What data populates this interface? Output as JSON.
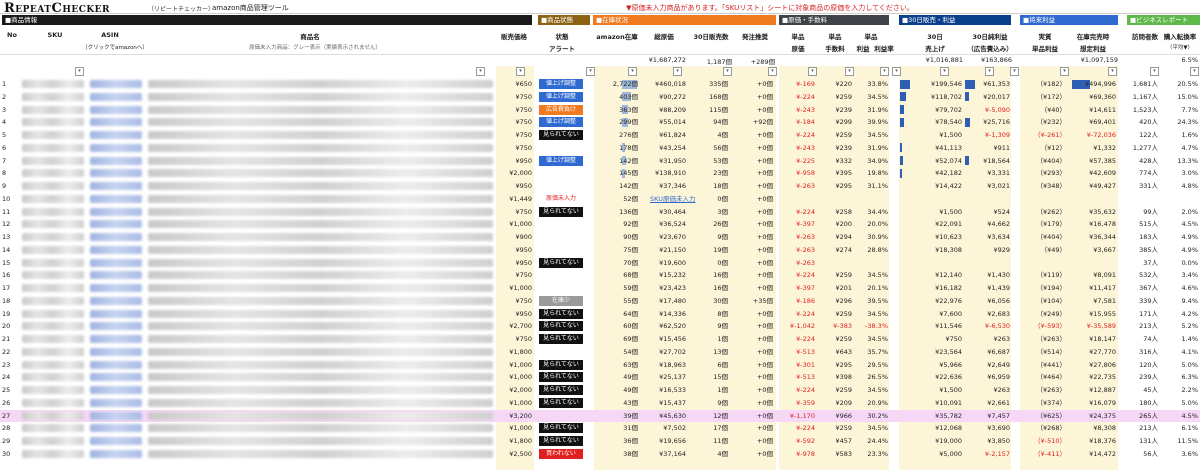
{
  "app": {
    "logo": "RepeatChecker",
    "logo_sub": "（リピートチェッカー）",
    "tool_name": "amazon商品管理ツール",
    "warning": "▼原価未入力商品があります。「SKUリスト」シートに対象商品の原価を入力してください。"
  },
  "sections": [
    {
      "label": "■商品情報",
      "color": "#1a1a1a"
    },
    {
      "label": "■商品状態",
      "color": "#8a6212"
    },
    {
      "label": "■在庫状況",
      "color": "#f07a20"
    },
    {
      "label": "■原価・手数料",
      "color": "#3f4348"
    },
    {
      "label": "■30日販売・利益",
      "color": "#0a3f8a"
    },
    {
      "label": "■将来利益",
      "color": "#2f6ad0"
    },
    {
      "label": "■ビジネスレポート",
      "color": "#5fb84a"
    }
  ],
  "headers": {
    "no": "No",
    "sku": "SKU",
    "asin": "ASIN",
    "asin_sub": "（クリックでamazonへ）",
    "product": "商品名",
    "product_sub": "原価未入力商品：グレー表示（実績表示されません）",
    "price": "販売価格",
    "status": "状態",
    "alert": "アラート",
    "stock": "amazon在庫",
    "total_cost": "総原価",
    "sales30": "30日販売数",
    "order_rec": "発注推奨",
    "unit_cost": "単品",
    "unit_cost2": "原価",
    "fee": "単品",
    "fee2": "手数料",
    "profit": "単品",
    "profit2": "利益",
    "margin": "単品",
    "margin2": "利益率",
    "sales30d": "30日",
    "sales30d2": "売上げ",
    "profit30": "30日純利益",
    "profit30_2": "（広告費込み）",
    "real": "実質",
    "real2": "単品利益",
    "future": "在庫完売時",
    "future2": "想定利益",
    "visits": "訪問者数",
    "conv": "購入転換率",
    "conv2": "（平均▼）"
  },
  "totals": {
    "total_cost": "¥1,687,272",
    "sales30": "1,187個",
    "order_rec": "+289個",
    "sales30d": "¥1,016,881",
    "profit30": "¥163,866",
    "future": "¥1,097,159",
    "conv": "6.5%"
  },
  "rows": [
    {
      "no": "1",
      "price": "¥650",
      "tag": "値上げ調整",
      "tagc": "#2f6ad0",
      "stock": "2,722個",
      "cost": "¥460,018",
      "s30": "335個",
      "rec": "+0個",
      "uc": "¥-169",
      "fee": "¥220",
      "pr": "33.8%",
      "sales": "¥199,546",
      "np": "¥61,353",
      "real": "（¥182）",
      "fut": "¥494,996",
      "vis": "1,681人",
      "cv": "20.5%",
      "sb": 1,
      "pb": 0.5,
      "fb": 1
    },
    {
      "no": "2",
      "price": "¥750",
      "tag": "値上げ調整",
      "tagc": "#2f6ad0",
      "stock": "403個",
      "cost": "¥90,272",
      "s30": "168個",
      "rec": "+0個",
      "uc": "¥-224",
      "fee": "¥259",
      "pr": "34.5%",
      "sales": "¥118,702",
      "np": "¥20,017",
      "real": "（¥172）",
      "fut": "¥69,360",
      "vis": "1,167人",
      "cv": "15.0%",
      "sb": 0.6,
      "pb": 0.2
    },
    {
      "no": "3",
      "price": "¥750",
      "tag": "広告費負け",
      "tagc": "#f07a20",
      "stock": "363個",
      "cost": "¥88,209",
      "s30": "115個",
      "rec": "+0個",
      "uc": "¥-243",
      "fee": "¥239",
      "pr": "31.9%",
      "sales": "¥79,702",
      "np": "¥-5,090",
      "npn": 1,
      "real": "（¥40）",
      "fut": "¥14,611",
      "vis": "1,523人",
      "cv": "7.7%",
      "sb": 0.4
    },
    {
      "no": "4",
      "price": "¥750",
      "tag": "値上げ調整",
      "tagc": "#2f6ad0",
      "stock": "299個",
      "cost": "¥55,014",
      "s30": "94個",
      "rec": "+92個",
      "uc": "¥-184",
      "fee": "¥299",
      "pr": "39.9%",
      "sales": "¥78,540",
      "np": "¥25,716",
      "real": "（¥232）",
      "fut": "¥69,401",
      "vis": "420人",
      "cv": "24.3%",
      "sb": 0.4,
      "pb": 0.25
    },
    {
      "no": "5",
      "price": "¥750",
      "tag": "見られてない",
      "tagc": "#111",
      "stock": "276個",
      "cost": "¥61,824",
      "s30": "4個",
      "rec": "+0個",
      "uc": "¥-224",
      "fee": "¥259",
      "pr": "34.5%",
      "sales": "¥1,500",
      "np": "¥-1,309",
      "npn": 1,
      "real": "（¥-261）",
      "realn": 1,
      "fut": "¥-72,036",
      "futn": 1,
      "vis": "122人",
      "cv": "1.6%"
    },
    {
      "no": "6",
      "price": "¥750",
      "tag": "",
      "tagc": "",
      "stock": "178個",
      "cost": "¥43,254",
      "s30": "56個",
      "rec": "+0個",
      "uc": "¥-243",
      "fee": "¥239",
      "pr": "31.9%",
      "sales": "¥41,113",
      "np": "¥911",
      "real": "（¥12）",
      "fut": "¥1,332",
      "vis": "1,277人",
      "cv": "4.7%",
      "sb": 0.2
    },
    {
      "no": "7",
      "price": "¥950",
      "tag": "値上げ調整",
      "tagc": "#2f6ad0",
      "stock": "142個",
      "cost": "¥31,950",
      "s30": "53個",
      "rec": "+0個",
      "uc": "¥-225",
      "fee": "¥332",
      "pr": "34.9%",
      "sales": "¥52,074",
      "np": "¥18,564",
      "real": "（¥404）",
      "fut": "¥57,385",
      "vis": "428人",
      "cv": "13.3%",
      "sb": 0.25,
      "pb": 0.18
    },
    {
      "no": "8",
      "price": "¥2,000",
      "tag": "",
      "tagc": "",
      "stock": "145個",
      "cost": "¥138,910",
      "s30": "23個",
      "rec": "+0個",
      "uc": "¥-958",
      "fee": "¥395",
      "pr": "19.8%",
      "sales": "¥42,182",
      "np": "¥3,331",
      "real": "（¥293）",
      "fut": "¥42,609",
      "vis": "774人",
      "cv": "3.0%",
      "sb": 0.2
    },
    {
      "no": "9",
      "price": "¥950",
      "tag": "",
      "tagc": "",
      "stock": "142個",
      "cost": "¥37,346",
      "s30": "18個",
      "rec": "+0個",
      "uc": "¥-263",
      "fee": "¥295",
      "pr": "31.1%",
      "sales": "¥14,422",
      "np": "¥3,021",
      "real": "（¥348）",
      "fut": "¥49,427",
      "vis": "331人",
      "cv": "4.8%"
    },
    {
      "no": "10",
      "price": "¥1,449",
      "tag": "原価未入力",
      "tagc": "none",
      "stock": "52個",
      "cost": "SKU原価未入力",
      "costl": 1,
      "s30": "0個",
      "rec": "+0個",
      "uc": "",
      "fee": "",
      "pr": "",
      "sales": "",
      "np": "",
      "real": "",
      "fut": "",
      "vis": "",
      "cv": ""
    },
    {
      "no": "11",
      "price": "¥750",
      "tag": "見られてない",
      "tagc": "#111",
      "stock": "136個",
      "cost": "¥30,464",
      "s30": "3個",
      "rec": "+0個",
      "uc": "¥-224",
      "fee": "¥258",
      "pr": "34.4%",
      "sales": "¥1,500",
      "np": "¥524",
      "real": "（¥262）",
      "fut": "¥35,632",
      "vis": "99人",
      "cv": "2.0%"
    },
    {
      "no": "12",
      "price": "¥1,000",
      "tag": "",
      "tagc": "",
      "stock": "92個",
      "cost": "¥36,524",
      "s30": "26個",
      "rec": "+0個",
      "uc": "¥-397",
      "fee": "¥200",
      "pr": "20.0%",
      "sales": "¥22,091",
      "np": "¥4,662",
      "real": "（¥179）",
      "fut": "¥16,478",
      "vis": "515人",
      "cv": "4.5%"
    },
    {
      "no": "13",
      "price": "¥900",
      "tag": "",
      "tagc": "",
      "stock": "90個",
      "cost": "¥23,670",
      "s30": "9個",
      "rec": "+0個",
      "uc": "¥-263",
      "fee": "¥294",
      "pr": "30.9%",
      "sales": "¥10,623",
      "np": "¥3,634",
      "real": "（¥404）",
      "fut": "¥36,344",
      "vis": "183人",
      "cv": "4.9%"
    },
    {
      "no": "14",
      "price": "¥950",
      "tag": "",
      "tagc": "",
      "stock": "75個",
      "cost": "¥21,150",
      "s30": "19個",
      "rec": "+0個",
      "uc": "¥-263",
      "fee": "¥274",
      "pr": "28.8%",
      "sales": "¥18,308",
      "np": "¥929",
      "real": "（¥49）",
      "fut": "¥3,667",
      "vis": "385人",
      "cv": "4.9%"
    },
    {
      "no": "15",
      "price": "¥950",
      "tag": "見られてない",
      "tagc": "#111",
      "stock": "70個",
      "cost": "¥19,600",
      "s30": "0個",
      "rec": "+0個",
      "uc": "¥-263",
      "fee": "",
      "pr": "",
      "sales": "",
      "np": "",
      "real": "",
      "fut": "",
      "vis": "37人",
      "cv": "0.0%"
    },
    {
      "no": "16",
      "price": "¥750",
      "tag": "",
      "tagc": "",
      "stock": "68個",
      "cost": "¥15,232",
      "s30": "16個",
      "rec": "+0個",
      "uc": "¥-224",
      "fee": "¥259",
      "pr": "34.5%",
      "sales": "¥12,140",
      "np": "¥1,430",
      "real": "（¥119）",
      "fut": "¥8,091",
      "vis": "532人",
      "cv": "3.4%"
    },
    {
      "no": "17",
      "price": "¥1,000",
      "tag": "",
      "tagc": "",
      "stock": "59個",
      "cost": "¥23,423",
      "s30": "16個",
      "rec": "+0個",
      "uc": "¥-397",
      "fee": "¥201",
      "pr": "20.1%",
      "sales": "¥16,182",
      "np": "¥1,439",
      "real": "（¥194）",
      "fut": "¥11,417",
      "vis": "367人",
      "cv": "4.6%"
    },
    {
      "no": "18",
      "price": "¥750",
      "tag": "在庫少",
      "tagc": "#9a9a9a",
      "stock": "55個",
      "cost": "¥17,480",
      "s30": "30個",
      "rec": "+35個",
      "uc": "¥-186",
      "fee": "¥296",
      "pr": "39.5%",
      "sales": "¥22,976",
      "np": "¥6,056",
      "real": "（¥104）",
      "fut": "¥7,581",
      "vis": "339人",
      "cv": "9.4%"
    },
    {
      "no": "19",
      "price": "¥950",
      "tag": "見られてない",
      "tagc": "#111",
      "stock": "64個",
      "cost": "¥14,336",
      "s30": "8個",
      "rec": "+0個",
      "uc": "¥-224",
      "fee": "¥259",
      "pr": "34.5%",
      "sales": "¥7,600",
      "np": "¥2,683",
      "real": "（¥249）",
      "fut": "¥15,955",
      "vis": "171人",
      "cv": "4.2%"
    },
    {
      "no": "20",
      "price": "¥2,700",
      "tag": "見られてない",
      "tagc": "#111",
      "stock": "60個",
      "cost": "¥62,520",
      "s30": "9個",
      "rec": "+0個",
      "uc": "¥-1,042",
      "fee": "¥-383",
      "pr": "-38.3%",
      "prn": 1,
      "feen": 1,
      "sales": "¥11,546",
      "np": "¥-6,530",
      "npn": 1,
      "real": "（¥-593）",
      "realn": 1,
      "fut": "¥-35,589",
      "futn": 1,
      "vis": "213人",
      "cv": "5.2%"
    },
    {
      "no": "21",
      "price": "¥750",
      "tag": "見られてない",
      "tagc": "#111",
      "stock": "69個",
      "cost": "¥15,456",
      "s30": "1個",
      "rec": "+0個",
      "uc": "¥-224",
      "fee": "¥259",
      "pr": "34.5%",
      "sales": "¥750",
      "np": "¥263",
      "real": "（¥263）",
      "fut": "¥18,147",
      "vis": "74人",
      "cv": "1.4%"
    },
    {
      "no": "22",
      "price": "¥1,800",
      "tag": "",
      "tagc": "",
      "stock": "54個",
      "cost": "¥27,702",
      "s30": "13個",
      "rec": "+0個",
      "uc": "¥-513",
      "fee": "¥643",
      "pr": "35.7%",
      "sales": "¥23,564",
      "np": "¥6,687",
      "real": "（¥514）",
      "fut": "¥27,770",
      "vis": "316人",
      "cv": "4.1%"
    },
    {
      "no": "23",
      "price": "¥1,000",
      "tag": "見られてない",
      "tagc": "#111",
      "stock": "63個",
      "cost": "¥18,963",
      "s30": "6個",
      "rec": "+0個",
      "uc": "¥-301",
      "fee": "¥295",
      "pr": "29.5%",
      "sales": "¥5,966",
      "np": "¥2,649",
      "real": "（¥441）",
      "fut": "¥27,806",
      "vis": "120人",
      "cv": "5.0%"
    },
    {
      "no": "24",
      "price": "¥1,000",
      "tag": "見られてない",
      "tagc": "#111",
      "stock": "49個",
      "cost": "¥25,137",
      "s30": "15個",
      "rec": "+0個",
      "uc": "¥-513",
      "fee": "¥398",
      "pr": "26.5%",
      "sales": "¥22,636",
      "np": "¥6,959",
      "real": "（¥464）",
      "fut": "¥22,735",
      "vis": "239人",
      "cv": "6.3%"
    },
    {
      "no": "25",
      "price": "¥2,000",
      "tag": "見られてない",
      "tagc": "#111",
      "stock": "49個",
      "cost": "¥16,533",
      "s30": "1個",
      "rec": "+0個",
      "uc": "¥-224",
      "fee": "¥259",
      "pr": "34.5%",
      "sales": "¥1,500",
      "np": "¥263",
      "real": "（¥263）",
      "fut": "¥12,887",
      "vis": "45人",
      "cv": "2.2%"
    },
    {
      "no": "26",
      "price": "¥1,000",
      "tag": "見られてない",
      "tagc": "#111",
      "stock": "43個",
      "cost": "¥15,437",
      "s30": "9個",
      "rec": "+0個",
      "uc": "¥-359",
      "fee": "¥209",
      "pr": "20.9%",
      "sales": "¥10,091",
      "np": "¥2,661",
      "real": "（¥374）",
      "fut": "¥16,079",
      "vis": "180人",
      "cv": "5.0%"
    },
    {
      "no": "27",
      "price": "¥3,200",
      "tag": "",
      "tagc": "",
      "stock": "39個",
      "cost": "¥45,630",
      "s30": "12個",
      "rec": "+0個",
      "uc": "¥-1,170",
      "fee": "¥966",
      "pr": "30.2%",
      "sales": "¥35,782",
      "np": "¥7,457",
      "real": "（¥625）",
      "fut": "¥24,375",
      "vis": "265人",
      "cv": "4.5%",
      "pink": 1
    },
    {
      "no": "28",
      "price": "¥1,000",
      "tag": "見られてない",
      "tagc": "#111",
      "stock": "31個",
      "cost": "¥7,502",
      "s30": "17個",
      "rec": "+0個",
      "uc": "¥-224",
      "fee": "¥259",
      "pr": "34.5%",
      "sales": "¥12,068",
      "np": "¥3,690",
      "real": "（¥268）",
      "fut": "¥8,308",
      "vis": "213人",
      "cv": "6.1%"
    },
    {
      "no": "29",
      "price": "¥1,800",
      "tag": "見られてない",
      "tagc": "#111",
      "stock": "36個",
      "cost": "¥19,656",
      "s30": "11個",
      "rec": "+0個",
      "uc": "¥-592",
      "fee": "¥457",
      "pr": "24.4%",
      "sales": "¥19,000",
      "np": "¥3,850",
      "real": "（¥-510）",
      "realn": 1,
      "fut": "¥18,376",
      "vis": "131人",
      "cv": "11.5%"
    },
    {
      "no": "30",
      "price": "¥2,500",
      "tag": "買われない",
      "tagc": "#e02020",
      "stock": "38個",
      "cost": "¥37,164",
      "s30": "4個",
      "rec": "+0個",
      "uc": "¥-978",
      "fee": "¥583",
      "pr": "23.3%",
      "sales": "¥5,000",
      "np": "¥-2,157",
      "npn": 1,
      "real": "（¥-411）",
      "realn": 1,
      "fut": "¥14,472",
      "vis": "56人",
      "cv": "3.6%"
    }
  ]
}
